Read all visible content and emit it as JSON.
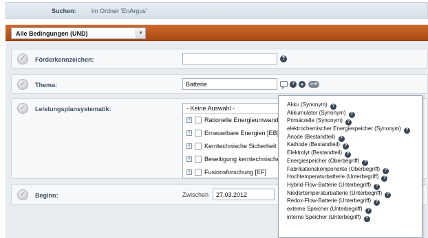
{
  "search": {
    "label": "Suchen:",
    "scope": "im Ordner 'EnArgus'"
  },
  "conditions": {
    "selected": "Alle Bedingungen (UND)"
  },
  "fields": {
    "foerderkennzeichen": {
      "label": "Förderkennzeichen:",
      "value": ""
    },
    "thema": {
      "label": "Thema:",
      "value": "Batterie"
    },
    "leistungsplan": {
      "label": "Leistungsplansystematik:",
      "selected": "- Keine Auswahl -",
      "items": [
        "Rationelle Energieumwandlung",
        "Erneuerbare Energien [EB]",
        "Kerntechnische Sicherheit und",
        "Beseitigung kerntechnischer",
        "Fusionsforschung [EF]"
      ]
    },
    "beginn": {
      "label": "Beginn:",
      "between_label": "Zwischen",
      "value": "27.03.2012"
    }
  },
  "icons": {
    "help": "?",
    "add": "+",
    "pill": "a=b"
  },
  "suggestions": [
    "Akku (Synonym)",
    "Akkumulator (Synonym)",
    "Primärzelle (Synonym)",
    "elektrochemischer Energiespeicher (Synonym)",
    "Anode (Bestandteil)",
    "Kathode (Bestandteil)",
    "Elektrolyt (Bestandteil)",
    "Energiespeicher (Oberbegriff)",
    "Fabrikationskomponente (Oberbegriff)",
    "Hochtemperaturbatterie (Unterbegriff)",
    "Hybrid-Flow-Batterie (Unterbegriff)",
    "Niedertemperaturbatterie (Unterbegriff)",
    "Redox-Flow-Batterie (Unterbegriff)",
    "externe Speicher (Unterbegriff)",
    "interne Speicher (Unterbegriff)"
  ],
  "colors": {
    "accent": "#b8531b",
    "row_label": "#3b4e62"
  }
}
